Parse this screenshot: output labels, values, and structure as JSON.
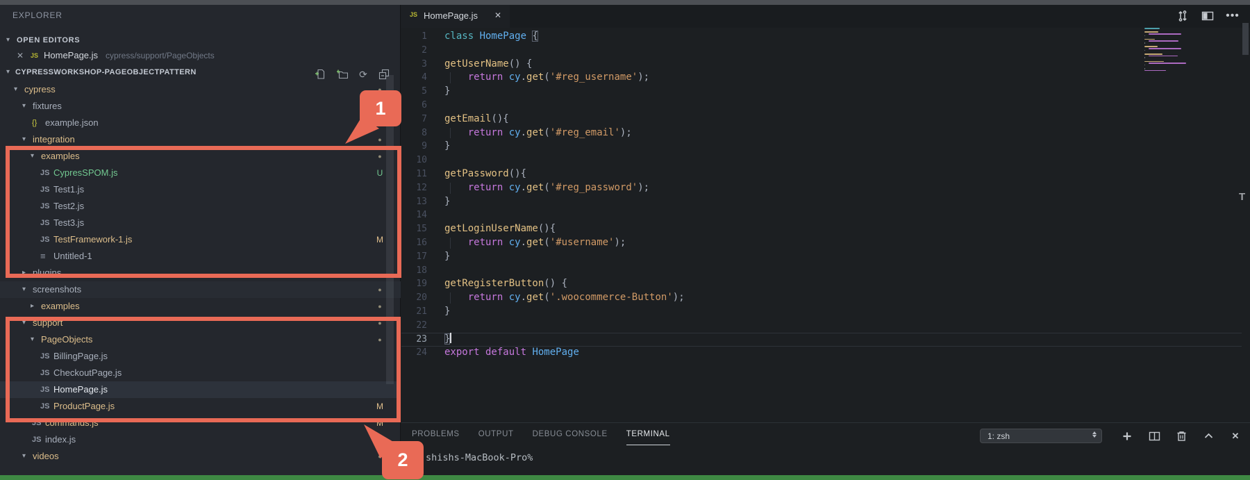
{
  "colors": {
    "annotation_red": "#e96a56",
    "status_green": "#3e8943",
    "modified_yellow": "#e2c08d",
    "untracked_green": "#73c991"
  },
  "glyphs": {
    "twistie_open": "▾",
    "twistie_closed": "▸",
    "close": "✕",
    "js_badge": "JS",
    "json_icon": "{}",
    "plain_file_icon": "≡",
    "dot_badge": "●",
    "ellipsis": "⋯",
    "refresh": "⟳"
  },
  "sidebar": {
    "title": "EXPLORER",
    "open_editors": {
      "label": "OPEN EDITORS",
      "item": {
        "label": "HomePage.js",
        "path": "cypress/support/PageObjects"
      }
    },
    "project": {
      "label": "CYPRESSWORKSHOP-PAGEOBJECTPATTERN",
      "actions": [
        "new-file",
        "new-folder",
        "refresh",
        "collapse-all"
      ]
    },
    "tree": [
      {
        "label": "cypress",
        "level": 1,
        "kind": "folder-open",
        "tone": "mod",
        "badge": "dot"
      },
      {
        "label": "fixtures",
        "level": 2,
        "kind": "folder-open",
        "tone": "plain",
        "badge": ""
      },
      {
        "label": "example.json",
        "level": 3,
        "kind": "file-json",
        "tone": "plain",
        "badge": ""
      },
      {
        "label": "integration",
        "level": 2,
        "kind": "folder-open",
        "tone": "mod",
        "badge": "dot"
      },
      {
        "label": "examples",
        "level": 3,
        "kind": "folder-open",
        "tone": "mod",
        "badge": "dot"
      },
      {
        "label": "CypresSPOM.js",
        "level": 4,
        "kind": "file-js",
        "tone": "untracked",
        "badge": "U"
      },
      {
        "label": "Test1.js",
        "level": 4,
        "kind": "file-js",
        "tone": "plain",
        "badge": ""
      },
      {
        "label": "Test2.js",
        "level": 4,
        "kind": "file-js",
        "tone": "plain",
        "badge": ""
      },
      {
        "label": "Test3.js",
        "level": 4,
        "kind": "file-js",
        "tone": "plain",
        "badge": ""
      },
      {
        "label": "TestFramework-1.js",
        "level": 4,
        "kind": "file-js",
        "tone": "mod",
        "badge": "M"
      },
      {
        "label": "Untitled-1",
        "level": 4,
        "kind": "file-plain",
        "tone": "plain",
        "badge": ""
      },
      {
        "label": "plugins",
        "level": 2,
        "kind": "folder-closed",
        "tone": "plain",
        "badge": ""
      },
      {
        "label": "screenshots",
        "level": 2,
        "kind": "folder-open",
        "tone": "plain",
        "badge": "dot",
        "hover": true
      },
      {
        "label": "examples",
        "level": 3,
        "kind": "folder-closed",
        "tone": "mod",
        "badge": "dot"
      },
      {
        "label": "support",
        "level": 2,
        "kind": "folder-open",
        "tone": "mod",
        "badge": "dot"
      },
      {
        "label": "PageObjects",
        "level": 3,
        "kind": "folder-open",
        "tone": "mod",
        "badge": "dot"
      },
      {
        "label": "BillingPage.js",
        "level": 4,
        "kind": "file-js",
        "tone": "plain",
        "badge": ""
      },
      {
        "label": "CheckoutPage.js",
        "level": 4,
        "kind": "file-js",
        "tone": "plain",
        "badge": ""
      },
      {
        "label": "HomePage.js",
        "level": 4,
        "kind": "file-js",
        "tone": "plain",
        "badge": "",
        "selected": true
      },
      {
        "label": "ProductPage.js",
        "level": 4,
        "kind": "file-js",
        "tone": "mod",
        "badge": "M"
      },
      {
        "label": "commands.js",
        "level": 3,
        "kind": "file-js",
        "tone": "mod",
        "badge": "M"
      },
      {
        "label": "index.js",
        "level": 3,
        "kind": "file-js",
        "tone": "plain",
        "badge": ""
      },
      {
        "label": "videos",
        "level": 2,
        "kind": "folder-open",
        "tone": "mod",
        "badge": "dot"
      }
    ]
  },
  "editor": {
    "tab": {
      "label": "HomePage.js"
    },
    "actions": [
      "open-changes",
      "split-editor",
      "more-actions"
    ],
    "overview_letter": "T",
    "code_lines": [
      {
        "n": 1,
        "tokens": [
          [
            "kw2",
            "class "
          ],
          [
            "cls",
            "HomePage "
          ],
          [
            "match",
            "{"
          ]
        ]
      },
      {
        "n": 2,
        "tokens": []
      },
      {
        "n": 3,
        "tokens": [
          [
            "fn",
            "getUserName"
          ],
          [
            "pln",
            "() {"
          ]
        ]
      },
      {
        "n": 4,
        "indent": true,
        "tokens": [
          [
            "pln",
            "    "
          ],
          [
            "kw",
            "return "
          ],
          [
            "cy",
            "cy"
          ],
          [
            "pln",
            "."
          ],
          [
            "fn",
            "get"
          ],
          [
            "pln",
            "("
          ],
          [
            "str",
            "'#reg_username'"
          ],
          [
            "pln",
            ");"
          ]
        ]
      },
      {
        "n": 5,
        "tokens": [
          [
            "pln",
            "}"
          ]
        ]
      },
      {
        "n": 6,
        "tokens": []
      },
      {
        "n": 7,
        "tokens": [
          [
            "fn",
            "getEmail"
          ],
          [
            "pln",
            "(){"
          ]
        ]
      },
      {
        "n": 8,
        "indent": true,
        "tokens": [
          [
            "pln",
            "    "
          ],
          [
            "kw",
            "return "
          ],
          [
            "cy",
            "cy"
          ],
          [
            "pln",
            "."
          ],
          [
            "fn",
            "get"
          ],
          [
            "pln",
            "("
          ],
          [
            "str",
            "'#reg_email'"
          ],
          [
            "pln",
            ");"
          ]
        ]
      },
      {
        "n": 9,
        "tokens": [
          [
            "pln",
            "}"
          ]
        ]
      },
      {
        "n": 10,
        "tokens": []
      },
      {
        "n": 11,
        "tokens": [
          [
            "fn",
            "getPassword"
          ],
          [
            "pln",
            "(){"
          ]
        ]
      },
      {
        "n": 12,
        "indent": true,
        "tokens": [
          [
            "pln",
            "    "
          ],
          [
            "kw",
            "return "
          ],
          [
            "cy",
            "cy"
          ],
          [
            "pln",
            "."
          ],
          [
            "fn",
            "get"
          ],
          [
            "pln",
            "("
          ],
          [
            "str",
            "'#reg_password'"
          ],
          [
            "pln",
            ");"
          ]
        ]
      },
      {
        "n": 13,
        "tokens": [
          [
            "pln",
            "}"
          ]
        ]
      },
      {
        "n": 14,
        "tokens": []
      },
      {
        "n": 15,
        "tokens": [
          [
            "fn",
            "getLoginUserName"
          ],
          [
            "pln",
            "(){"
          ]
        ]
      },
      {
        "n": 16,
        "indent": true,
        "tokens": [
          [
            "pln",
            "    "
          ],
          [
            "kw",
            "return "
          ],
          [
            "cy",
            "cy"
          ],
          [
            "pln",
            "."
          ],
          [
            "fn",
            "get"
          ],
          [
            "pln",
            "("
          ],
          [
            "str",
            "'#username'"
          ],
          [
            "pln",
            ");"
          ]
        ]
      },
      {
        "n": 17,
        "tokens": [
          [
            "pln",
            "}"
          ]
        ]
      },
      {
        "n": 18,
        "tokens": []
      },
      {
        "n": 19,
        "tokens": [
          [
            "fn",
            "getRegisterButton"
          ],
          [
            "pln",
            "() {"
          ]
        ]
      },
      {
        "n": 20,
        "indent": true,
        "tokens": [
          [
            "pln",
            "    "
          ],
          [
            "kw",
            "return "
          ],
          [
            "cy",
            "cy"
          ],
          [
            "pln",
            "."
          ],
          [
            "fn",
            "get"
          ],
          [
            "pln",
            "("
          ],
          [
            "str",
            "'.woocommerce-Button'"
          ],
          [
            "pln",
            ");"
          ]
        ]
      },
      {
        "n": 21,
        "tokens": [
          [
            "pln",
            "}"
          ]
        ]
      },
      {
        "n": 22,
        "tokens": []
      },
      {
        "n": 23,
        "current": true,
        "tokens": [
          [
            "match",
            "}"
          ]
        ]
      },
      {
        "n": 24,
        "tokens": [
          [
            "kw",
            "export default "
          ],
          [
            "cls",
            "HomePage"
          ]
        ]
      }
    ]
  },
  "panel": {
    "tabs": [
      {
        "label": "PROBLEMS",
        "active": false
      },
      {
        "label": "OUTPUT",
        "active": false
      },
      {
        "label": "DEBUG CONSOLE",
        "active": false
      },
      {
        "label": "TERMINAL",
        "active": true
      }
    ],
    "shell_select": "1: zsh",
    "controls": [
      "new-terminal",
      "split-terminal",
      "kill-terminal",
      "maximize-panel",
      "close-panel"
    ],
    "terminal_line": "shishs-MacBook-Pro%"
  },
  "annotations": {
    "callout1": "1",
    "callout2": "2"
  }
}
